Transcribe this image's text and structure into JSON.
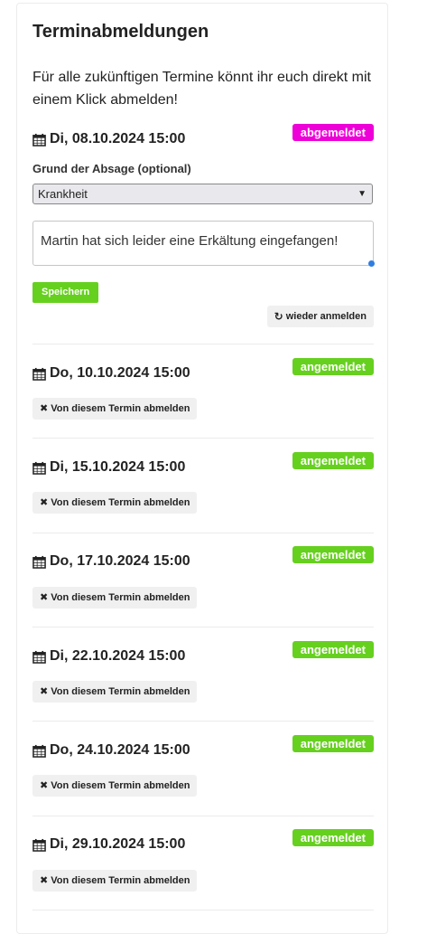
{
  "title": "Terminabmeldungen",
  "intro": "Für alle zukünftigen Termine könnt ihr euch direkt mit einem Klick abmelden!",
  "first": {
    "date": "Di, 08.10.2024 15:00",
    "status": "abgemeldet",
    "reason_label": "Grund der Absage (optional)",
    "reason_selected": "Krankheit",
    "comment": "Martin hat sich leider eine Erkältung eingefangen!",
    "save_label": "Speichern",
    "reregister_label": "wieder anmelden"
  },
  "entries": [
    {
      "date": "Do, 10.10.2024 15:00",
      "status": "angemeldet",
      "action": "Von diesem Termin abmelden"
    },
    {
      "date": "Di, 15.10.2024 15:00",
      "status": "angemeldet",
      "action": "Von diesem Termin abmelden"
    },
    {
      "date": "Do, 17.10.2024 15:00",
      "status": "angemeldet",
      "action": "Von diesem Termin abmelden"
    },
    {
      "date": "Di, 22.10.2024 15:00",
      "status": "angemeldet",
      "action": "Von diesem Termin abmelden"
    },
    {
      "date": "Do, 24.10.2024 15:00",
      "status": "angemeldet",
      "action": "Von diesem Termin abmelden"
    },
    {
      "date": "Di, 29.10.2024 15:00",
      "status": "angemeldet",
      "action": "Von diesem Termin abmelden"
    }
  ],
  "colors": {
    "abgemeldet": "#ee00d8",
    "angemeldet": "#66d01f",
    "save": "#66d01f"
  },
  "icons": {
    "calendar": "calendar-icon",
    "close": "close-icon",
    "refresh": "refresh-icon",
    "chevron": "chevron-down-icon"
  }
}
